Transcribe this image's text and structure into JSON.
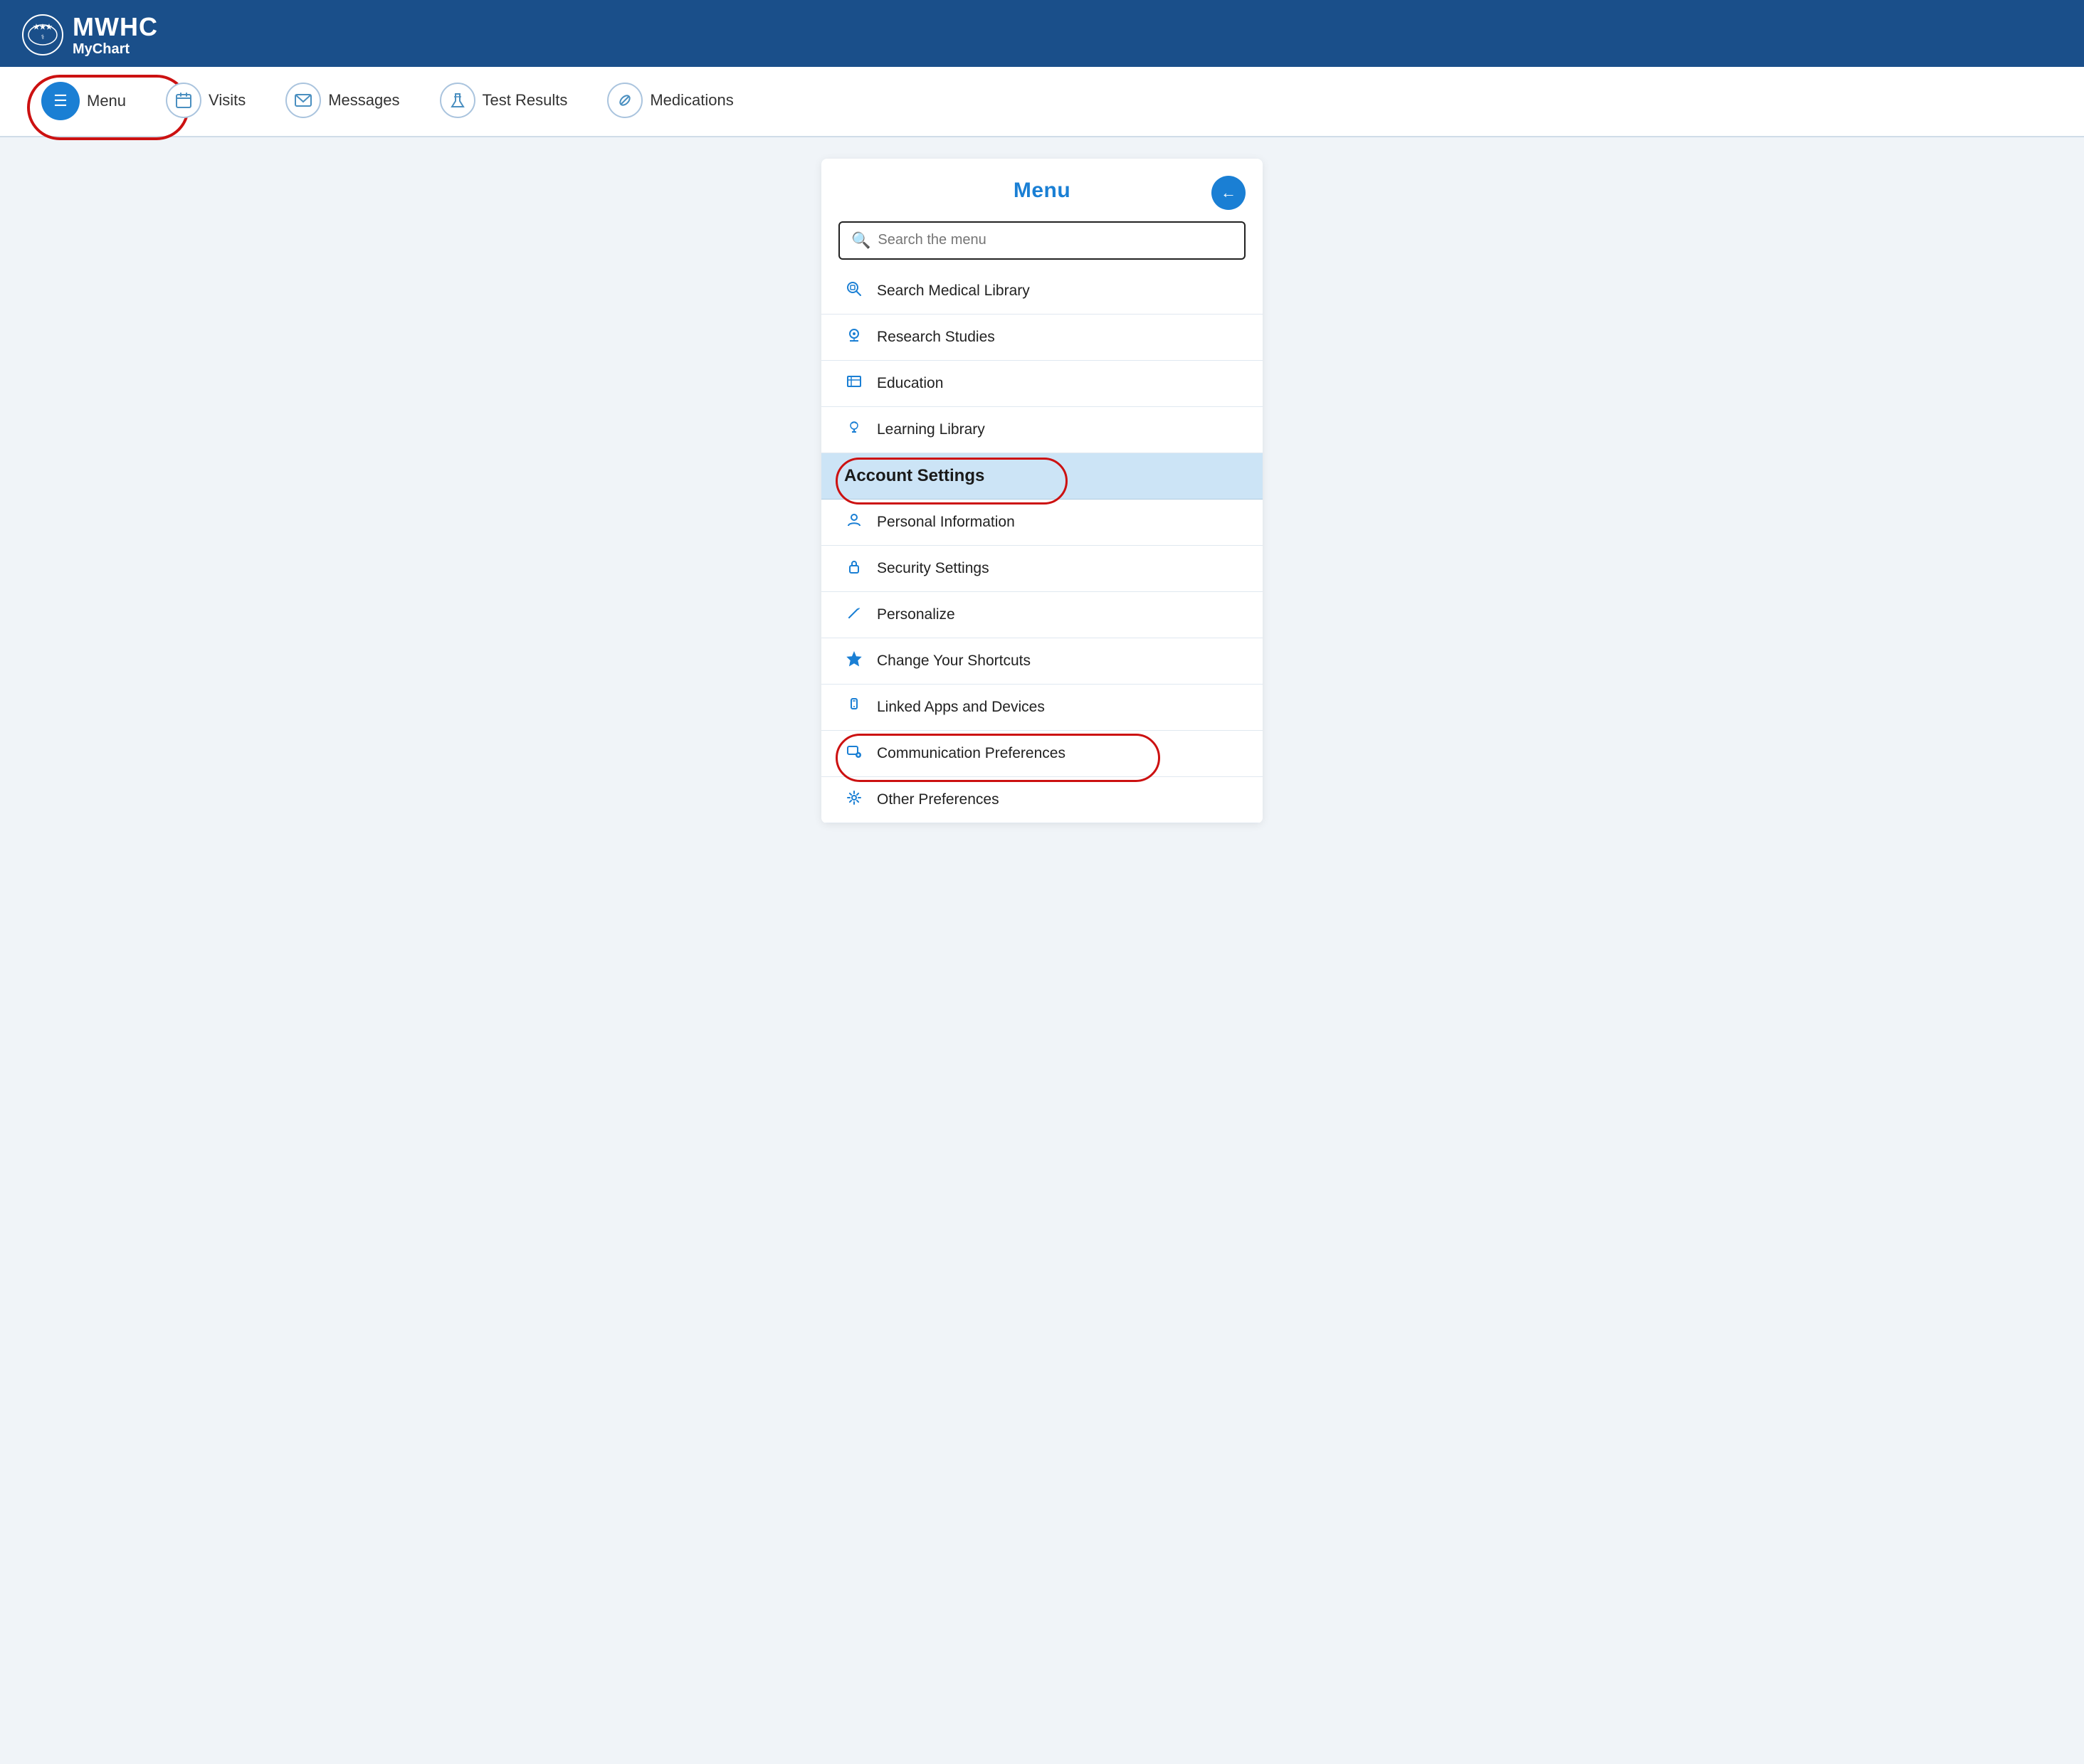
{
  "header": {
    "logo_text_mwhc": "MWHC",
    "logo_text_mychart_plain": "My",
    "logo_text_mychart_bold": "Chart"
  },
  "navbar": {
    "menu_label": "Menu",
    "visits_label": "Visits",
    "messages_label": "Messages",
    "test_results_label": "Test Results",
    "medications_label": "Medications"
  },
  "menu_panel": {
    "title": "Menu",
    "search_placeholder": "Search the menu",
    "back_icon": "←",
    "items": [
      {
        "label": "Search Medical Library",
        "icon": "🔍",
        "type": "item"
      },
      {
        "label": "Research Studies",
        "icon": "🔬",
        "type": "item"
      },
      {
        "label": "Education",
        "icon": "📚",
        "type": "item"
      },
      {
        "label": "Learning Library",
        "icon": "💡",
        "type": "item"
      },
      {
        "label": "Account Settings",
        "icon": "",
        "type": "section-header"
      },
      {
        "label": "Personal Information",
        "icon": "👤",
        "type": "item"
      },
      {
        "label": "Security Settings",
        "icon": "🔒",
        "type": "item"
      },
      {
        "label": "Personalize",
        "icon": "✏️",
        "type": "item"
      },
      {
        "label": "Change Your Shortcuts",
        "icon": "⭐",
        "type": "item"
      },
      {
        "label": "Linked Apps and Devices",
        "icon": "📱",
        "type": "item"
      },
      {
        "label": "Communication Preferences",
        "icon": "📧",
        "type": "item",
        "annotated": true
      },
      {
        "label": "Other Preferences",
        "icon": "⚙️",
        "type": "item"
      }
    ]
  }
}
